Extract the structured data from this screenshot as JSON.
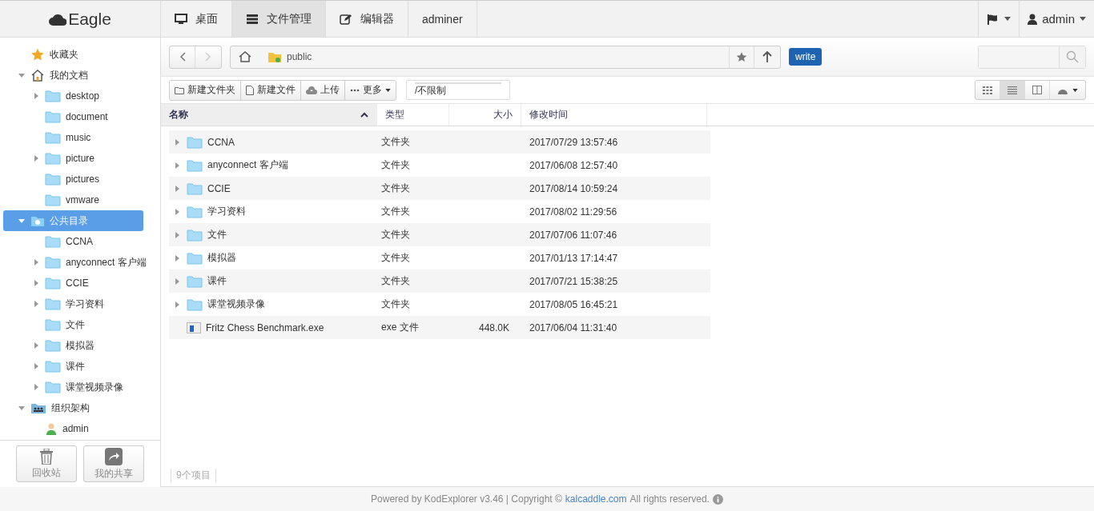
{
  "brand": "Eagle",
  "nav_tabs": [
    {
      "label": "桌面",
      "kind": "desktop",
      "selected": false
    },
    {
      "label": "文件管理",
      "kind": "files",
      "selected": true
    },
    {
      "label": "编辑器",
      "kind": "editor",
      "selected": false
    },
    {
      "label": "adminer",
      "kind": "plain",
      "selected": false
    }
  ],
  "user_menu": {
    "label": "admin"
  },
  "sidebar": {
    "tree": [
      {
        "label": "收藏夹",
        "kind": "star",
        "selected": false
      },
      {
        "label": "我的文档",
        "kind": "home",
        "expanded": true,
        "selected": false,
        "children": [
          {
            "label": "desktop",
            "kind": "folder",
            "expanded": false,
            "selected": false
          },
          {
            "label": "document",
            "kind": "folder",
            "selected": false
          },
          {
            "label": "music",
            "kind": "folder",
            "selected": false
          },
          {
            "label": "picture",
            "kind": "folder",
            "expanded": false,
            "selected": false
          },
          {
            "label": "pictures",
            "kind": "folder",
            "selected": false
          },
          {
            "label": "vmware",
            "kind": "folder",
            "selected": false
          }
        ]
      },
      {
        "label": "公共目录",
        "kind": "public",
        "expanded": true,
        "selected": true,
        "children": [
          {
            "label": "CCNA",
            "kind": "folder",
            "selected": false
          },
          {
            "label": "anyconnect 客户端",
            "kind": "folder",
            "expanded": false,
            "selected": false
          },
          {
            "label": "CCIE",
            "kind": "folder",
            "expanded": false,
            "selected": false
          },
          {
            "label": "学习资料",
            "kind": "folder",
            "expanded": false,
            "selected": false
          },
          {
            "label": "文件",
            "kind": "folder",
            "selected": false
          },
          {
            "label": "模拟器",
            "kind": "folder",
            "expanded": false,
            "selected": false
          },
          {
            "label": "课件",
            "kind": "folder",
            "expanded": false,
            "selected": false
          },
          {
            "label": "课堂视频录像",
            "kind": "folder",
            "expanded": false,
            "selected": false
          }
        ]
      },
      {
        "label": "组织架构",
        "kind": "group",
        "expanded": true,
        "selected": false,
        "children": [
          {
            "label": "admin",
            "kind": "user",
            "selected": false
          }
        ]
      }
    ],
    "buttons": [
      {
        "label": "回收站",
        "kind": "trash"
      },
      {
        "label": "我的共享",
        "kind": "share"
      }
    ]
  },
  "address_bar": {
    "path": [
      "public"
    ],
    "badge": "write"
  },
  "toolbar": [
    {
      "label": "新建文件夹",
      "kind": "folder"
    },
    {
      "label": "新建文件",
      "kind": "file"
    },
    {
      "label": "上传",
      "kind": "upload"
    },
    {
      "label": "更多",
      "kind": "more"
    }
  ],
  "quota": {
    "label": "/不限制"
  },
  "views": [
    {
      "kind": "grid",
      "selected": false
    },
    {
      "kind": "list",
      "selected": true
    },
    {
      "kind": "split",
      "selected": false
    }
  ],
  "table": {
    "columns": [
      {
        "label": "名称",
        "sorted": true
      },
      {
        "label": "类型",
        "sorted": false
      },
      {
        "label": "大小",
        "sorted": false
      },
      {
        "label": "修改时间",
        "sorted": false
      }
    ],
    "rows": [
      {
        "name": "CCNA",
        "kind": "folder",
        "type": "文件夹",
        "modified": "2017/07/29 13:57:46"
      },
      {
        "name": "anyconnect 客户端",
        "kind": "folder",
        "type": "文件夹",
        "modified": "2017/06/08 12:57:40"
      },
      {
        "name": "CCIE",
        "kind": "folder",
        "type": "文件夹",
        "modified": "2017/08/14 10:59:24"
      },
      {
        "name": "学习资料",
        "kind": "folder",
        "type": "文件夹",
        "modified": "2017/08/02 11:29:56"
      },
      {
        "name": "文件",
        "kind": "folder",
        "type": "文件夹",
        "modified": "2017/07/06 11:07:46"
      },
      {
        "name": "模拟器",
        "kind": "folder",
        "type": "文件夹",
        "modified": "2017/01/13 17:14:47"
      },
      {
        "name": "课件",
        "kind": "folder",
        "type": "文件夹",
        "modified": "2017/07/21 15:38:25"
      },
      {
        "name": "课堂视频录像",
        "kind": "folder",
        "type": "文件夹",
        "modified": "2017/08/05 16:45:21"
      },
      {
        "name": "Fritz Chess Benchmark.exe",
        "kind": "file",
        "type": "exe 文件",
        "size": "448.0K",
        "modified": "2017/06/04 11:31:40"
      }
    ]
  },
  "status_bar": {
    "count": "9个项目"
  },
  "footer": {
    "text": "Powered by KodExplorer v3.46 | Copyright ©",
    "link": "kalcaddle.com",
    "tail": "All rights reserved."
  }
}
